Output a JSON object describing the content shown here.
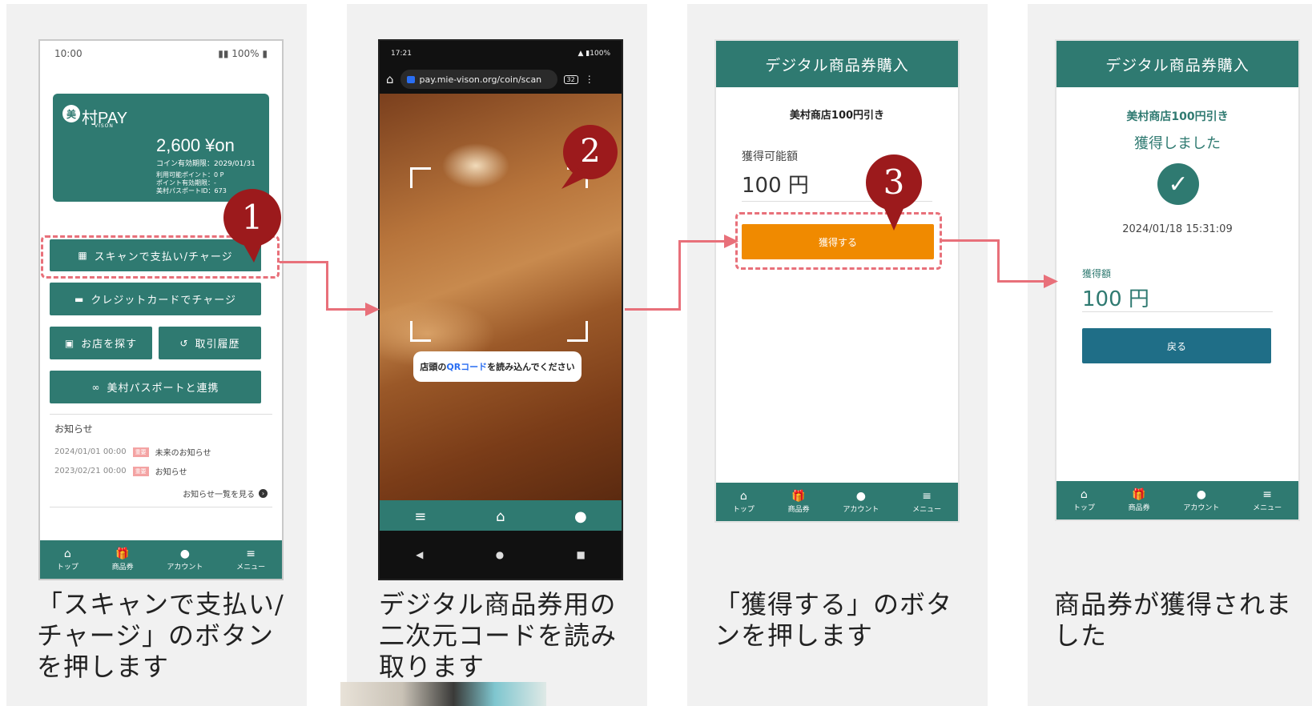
{
  "step1": {
    "status_time": "10:00",
    "status_battery": "100%",
    "card": {
      "logo_mark": "美",
      "logo": "村PAY",
      "logo_sub": "VISON",
      "balance": "2,600 ¥on",
      "expiry": "コイン有効期限：2029/01/31",
      "points": "利用可能ポイント：0 P",
      "points_expiry": "ポイント有効期限：-",
      "passport_id": "美村パスポートID：673"
    },
    "buttons": {
      "scan": "スキャンで支払い/チャージ",
      "credit": "クレジットカードでチャージ",
      "shops": "お店を探す",
      "history": "取引履歴",
      "passport": "美村パスポートと連携"
    },
    "news": {
      "title": "お知らせ",
      "items": [
        {
          "date": "2024/01/01 00:00",
          "tag": "重要",
          "text": "未来のお知らせ"
        },
        {
          "date": "2023/02/21 00:00",
          "tag": "重要",
          "text": "お知らせ"
        }
      ],
      "more": "お知らせ一覧を見る"
    },
    "marker": "1",
    "caption": [
      "「スキャンで支払い/",
      "チャージ」のボタン",
      "を押します"
    ]
  },
  "step2": {
    "status_time": "17:21",
    "status_right": "100%",
    "url": "pay.mie-vison.org/coin/scan",
    "tab_count": "32",
    "scan_message_pre": "店頭の",
    "scan_message_qr": "QRコード",
    "scan_message_post": "を読み込んでください",
    "marker": "2",
    "caption": [
      "デジタル商品券用の",
      "二次元コードを読み",
      "取ります"
    ]
  },
  "step3": {
    "header": "デジタル商品券購入",
    "product": "美村商店100円引き",
    "available_label": "獲得可能額",
    "available_value": "100 円",
    "acquire_button": "獲得する",
    "marker": "3",
    "caption": [
      "「獲得する」のボタ",
      "ンを押します"
    ]
  },
  "step4": {
    "header": "デジタル商品券購入",
    "product": "美村商店100円引き",
    "status": "獲得しました",
    "timestamp": "2024/01/18 15:31:09",
    "amount_label": "獲得額",
    "amount_value": "100 円",
    "back_button": "戻る",
    "caption": [
      "商品券が獲得されま",
      "した"
    ]
  },
  "nav": {
    "top": "トップ",
    "voucher": "商品券",
    "account": "アカウント",
    "menu": "メニュー"
  },
  "colors": {
    "brand": "#2f7a71",
    "accent_orange": "#f08a00",
    "highlight": "#e8707a",
    "marker": "#9c1a1c",
    "back_button": "#1f6e87"
  }
}
